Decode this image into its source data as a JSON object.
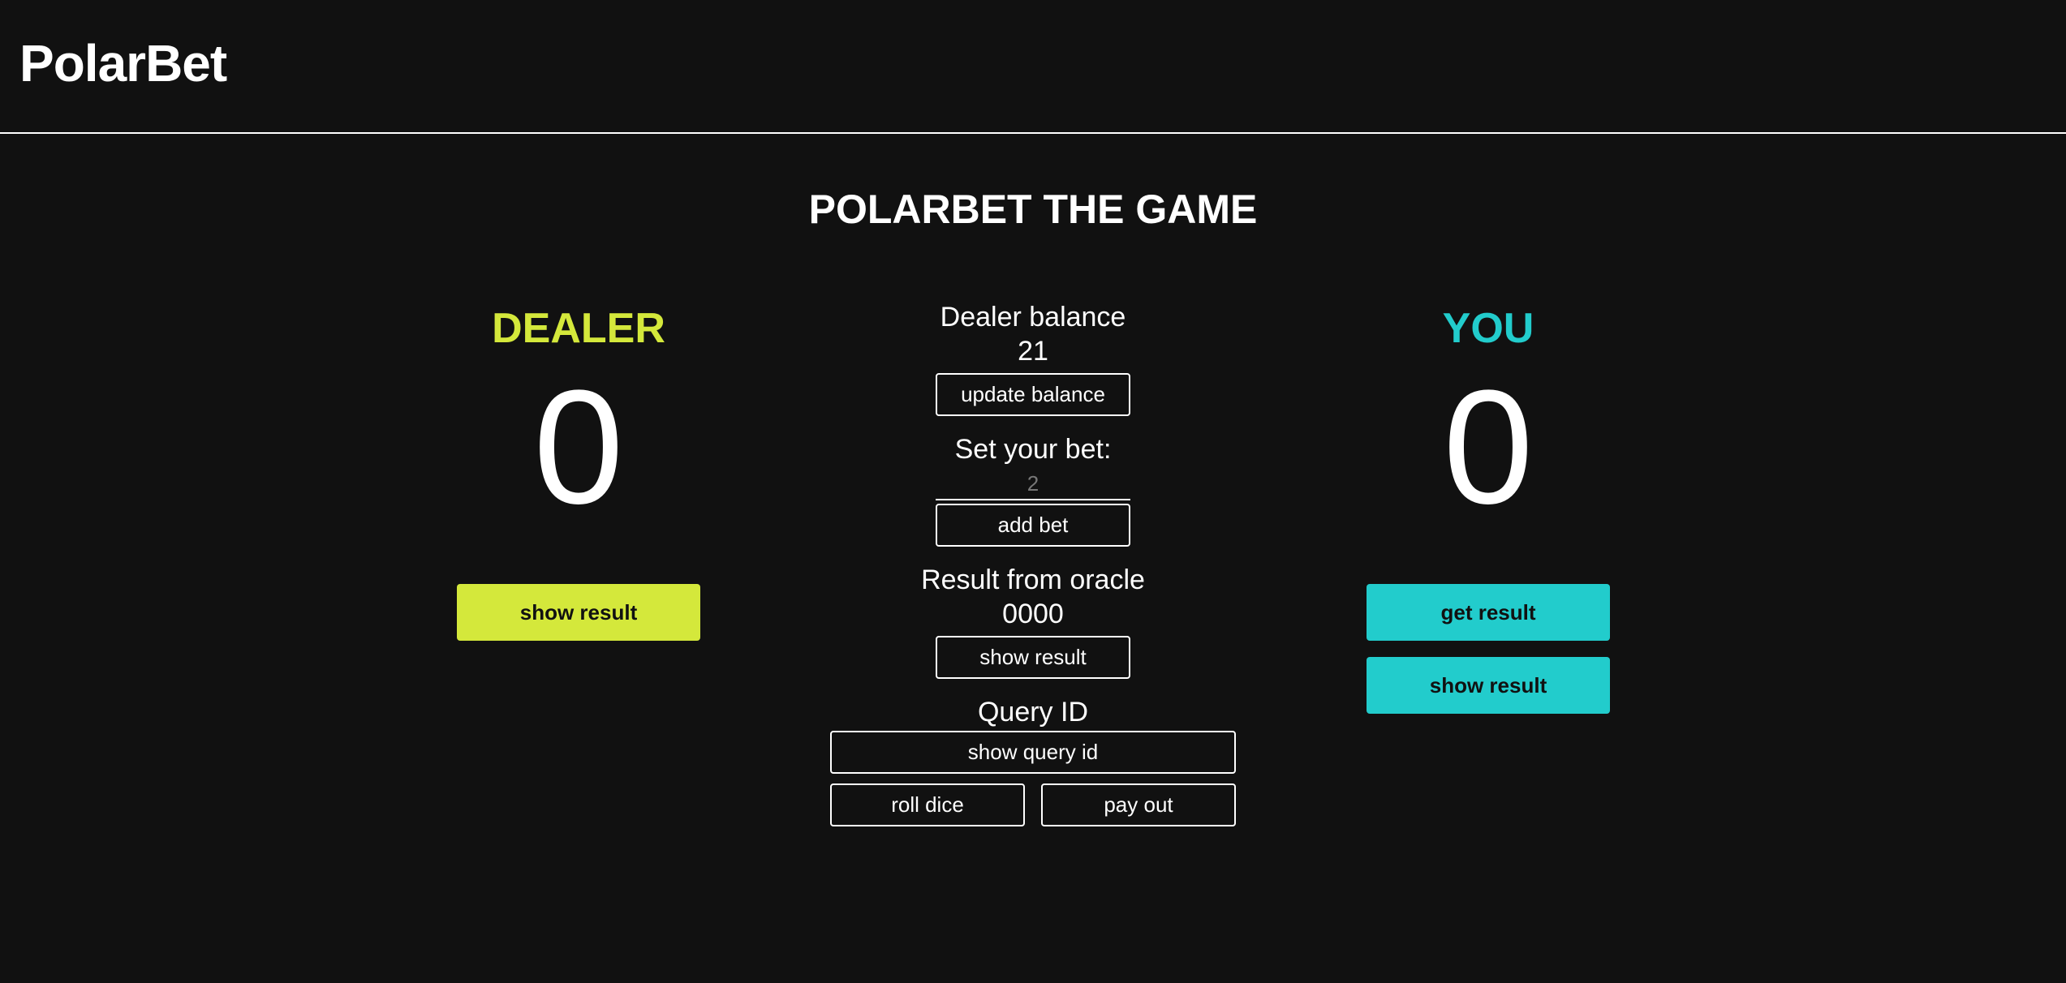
{
  "header": {
    "brand": "PolarBet"
  },
  "game": {
    "title": "POLARBET THE GAME"
  },
  "dealer": {
    "heading": "DEALER",
    "score": "0",
    "show_result_label": "show result"
  },
  "you": {
    "heading": "YOU",
    "score": "0",
    "get_result_label": "get result",
    "show_result_label": "show result"
  },
  "center": {
    "dealer_balance_label": "Dealer balance",
    "dealer_balance_value": "21",
    "update_balance_label": "update balance",
    "set_bet_label": "Set your bet:",
    "bet_placeholder": "2",
    "add_bet_label": "add bet",
    "oracle_label": "Result from oracle",
    "oracle_value": "0000",
    "oracle_show_result_label": "show result",
    "query_id_label": "Query ID",
    "show_query_id_label": "show query id",
    "roll_dice_label": "roll dice",
    "pay_out_label": "pay out"
  },
  "colors": {
    "background": "#111111",
    "dealer_accent": "#d4e83b",
    "you_accent": "#22cccc",
    "text": "#ffffff"
  }
}
